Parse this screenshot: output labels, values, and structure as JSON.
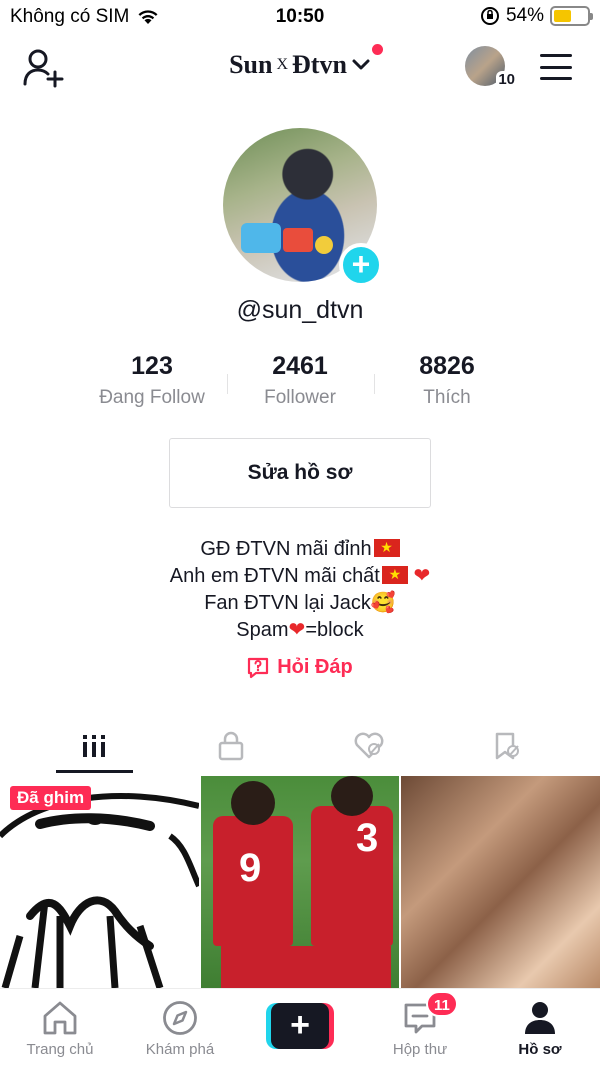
{
  "status_bar": {
    "carrier": "Không có SIM",
    "time": "10:50",
    "battery": "54%",
    "battery_level": 0.54
  },
  "header": {
    "title_left": "Sun",
    "title_x": "X",
    "title_right": "Đtvn",
    "account_count": "10"
  },
  "profile": {
    "username": "@sun_dtvn",
    "stats": [
      {
        "value": "123",
        "label": "Đang Follow"
      },
      {
        "value": "2461",
        "label": "Follower"
      },
      {
        "value": "8826",
        "label": "Thích"
      }
    ],
    "edit_button": "Sửa hồ sơ",
    "bio": {
      "line1": "GĐ ĐTVN mãi đỉnh",
      "line2": "Anh em ĐTVN mãi chất",
      "line3": "Fan ĐTVN lại Jack",
      "line4_a": "Spam",
      "line4_b": "=block"
    },
    "qa_link": "Hỏi Đáp"
  },
  "grid": {
    "pinned_label": "Đã ghim",
    "jersey_numbers": [
      "9",
      "3"
    ]
  },
  "bottom_nav": {
    "items": [
      {
        "label": "Trang chủ"
      },
      {
        "label": "Khám phá"
      },
      {
        "label": "Hộp thư",
        "badge": "11"
      },
      {
        "label": "Hồ sơ"
      }
    ]
  },
  "colors": {
    "accent": "#fe2c55",
    "cyan": "#20d5ec",
    "text": "#161823",
    "muted": "#8a8b91"
  }
}
